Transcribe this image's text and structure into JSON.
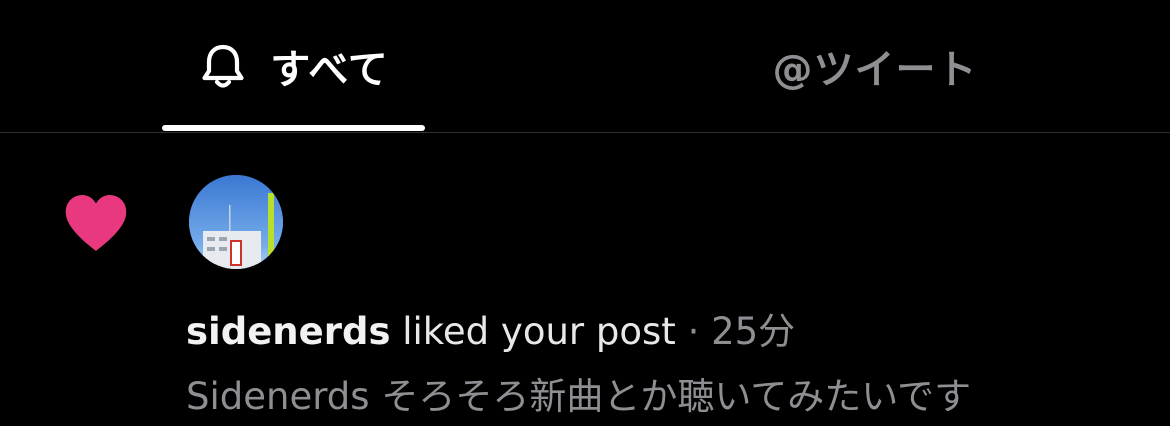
{
  "tabs": [
    {
      "label": "すべて",
      "icon": "bell-icon",
      "active": true
    },
    {
      "label": "@ツイート",
      "active": false
    }
  ],
  "notification": {
    "icon": "heart-icon",
    "icon_color": "#e8387e",
    "username": "sidenerds",
    "action": "liked your post",
    "separator": "·",
    "time": "25分",
    "preview": "Sidenerds そろそろ新曲とか聴いてみたいです"
  },
  "colors": {
    "background": "#000000",
    "active_tab": "#ffffff",
    "inactive_tab": "#8e8e93",
    "secondary_text": "#8e8e93"
  }
}
